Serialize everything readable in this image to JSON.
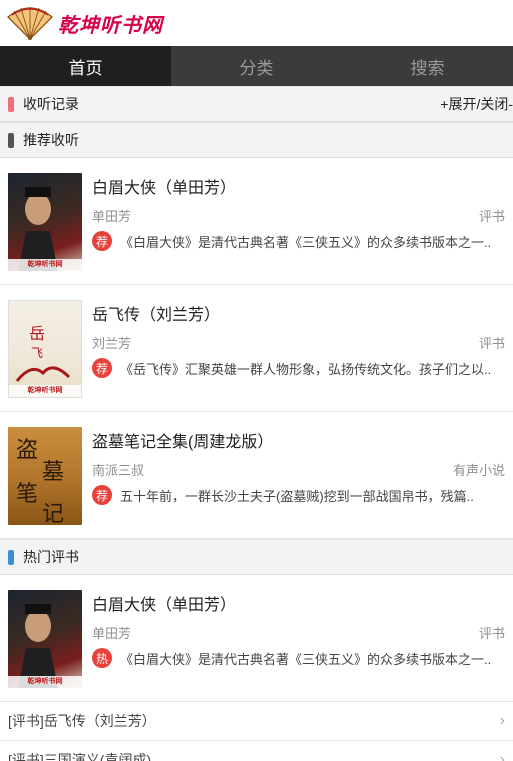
{
  "brand": {
    "logo_text": "乾坤听书网",
    "accent": "#d6004c"
  },
  "nav": {
    "tabs": [
      {
        "label": "首页",
        "active": true
      },
      {
        "label": "分类"
      },
      {
        "label": "搜索"
      }
    ]
  },
  "history": {
    "title": "收听记录",
    "toggle": "+展开/关闭-",
    "mark_color": "#f06d7a"
  },
  "recommend": {
    "title": "推荐收听",
    "mark_color": "#555555",
    "badge": "荐",
    "items": [
      {
        "title": "白眉大侠（单田芳）",
        "author": "单田芳",
        "category": "评书",
        "desc": "《白眉大侠》是清代古典名著《三侠五义》的众多续书版本之一..",
        "cover_strip": "乾坤听书网"
      },
      {
        "title": "岳飞传（刘兰芳）",
        "author": "刘兰芳",
        "category": "评书",
        "desc": "《岳飞传》汇聚英雄一群人物形象，弘扬传统文化。孩子们之以..",
        "cover_strip": "乾坤听书网"
      },
      {
        "title": "盗墓笔记全集(周建龙版）",
        "author": "南派三叔",
        "category": "有声小说",
        "desc": "五十年前，一群长沙土夫子(盗墓贼)挖到一部战国帛书，残篇.."
      }
    ]
  },
  "hot": {
    "title": "热门评书",
    "mark_color": "#3a8fd9",
    "badge": "热",
    "featured": {
      "title": "白眉大侠（单田芳）",
      "author": "单田芳",
      "category": "评书",
      "desc": "《白眉大侠》是清代古典名著《三侠五义》的众多续书版本之一..",
      "cover_strip": "乾坤听书网"
    },
    "links": [
      {
        "label": "[评书]岳飞传（刘兰芳）"
      },
      {
        "label": "[评书]三国演义(袁阔成)"
      }
    ]
  }
}
